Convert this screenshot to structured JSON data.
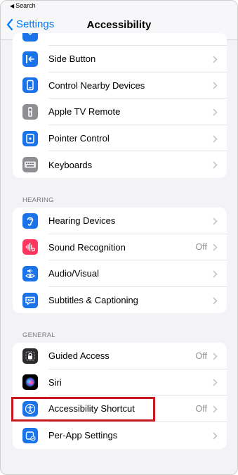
{
  "statusbar": {
    "back_app_label": "Search"
  },
  "nav": {
    "back_label": "Settings",
    "title": "Accessibility"
  },
  "colors": {
    "accent": "#007aff",
    "blue_icon": "#1a73e8",
    "gray_icon": "#8e8e93",
    "red_icon": "#ff375f",
    "highlight": "#c9191e"
  },
  "top_group": {
    "items": [
      {
        "label": "Side Button",
        "icon": "side-button-icon"
      },
      {
        "label": "Control Nearby Devices",
        "icon": "nearby-devices-icon"
      },
      {
        "label": "Apple TV Remote",
        "icon": "tv-remote-icon"
      },
      {
        "label": "Pointer Control",
        "icon": "pointer-control-icon"
      },
      {
        "label": "Keyboards",
        "icon": "keyboard-icon"
      }
    ]
  },
  "hearing": {
    "header": "HEARING",
    "items": [
      {
        "label": "Hearing Devices",
        "icon": "ear-icon"
      },
      {
        "label": "Sound Recognition",
        "value": "Off",
        "icon": "waveform-icon"
      },
      {
        "label": "Audio/Visual",
        "icon": "audio-visual-icon"
      },
      {
        "label": "Subtitles & Captioning",
        "icon": "captions-icon"
      }
    ]
  },
  "general": {
    "header": "GENERAL",
    "items": [
      {
        "label": "Guided Access",
        "value": "Off",
        "icon": "lock-icon"
      },
      {
        "label": "Siri",
        "icon": "siri-icon"
      },
      {
        "label": "Accessibility Shortcut",
        "value": "Off",
        "icon": "accessibility-icon"
      },
      {
        "label": "Per-App Settings",
        "icon": "per-app-icon"
      }
    ]
  }
}
